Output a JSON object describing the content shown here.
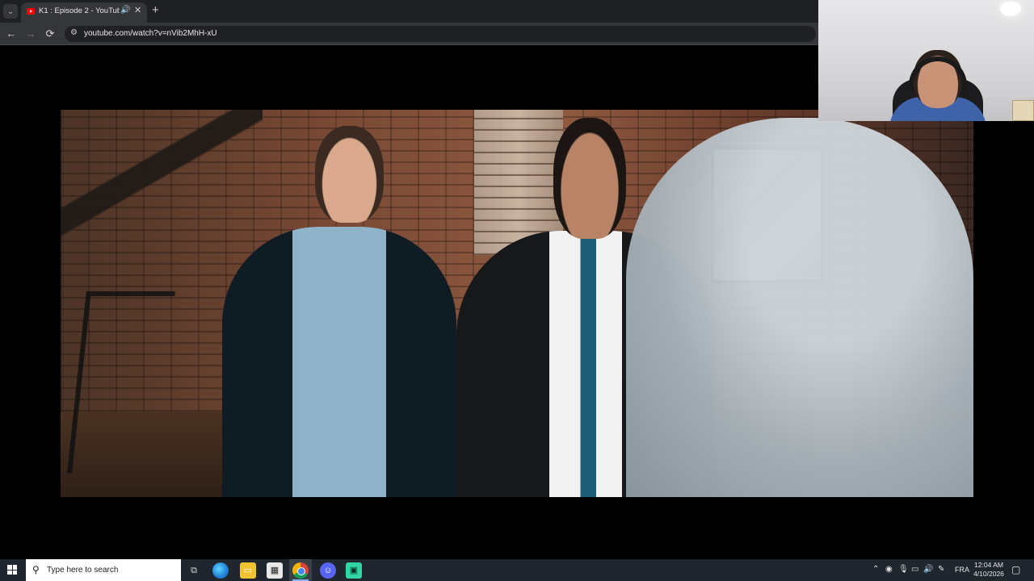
{
  "browser": {
    "tab": {
      "title": "K1 : Episode 2 - YouTube",
      "audio_icon": "speaker-icon",
      "close_icon": "close-icon"
    },
    "tab_menu_glyph": "⌄",
    "new_tab_glyph": "+",
    "nav": {
      "back_glyph": "←",
      "forward_glyph": "→",
      "reload_glyph": "⟳"
    },
    "address": {
      "site_info_icon": "tune-icon",
      "url": "youtube.com/watch?v=nVib2MhH-xU"
    }
  },
  "video": {
    "description_icon": "video-frame"
  },
  "webcam": {
    "icon": "webcam-overlay"
  },
  "taskbar": {
    "search_placeholder": "Type here to search",
    "apps": [
      "task-view",
      "edge",
      "file-explorer",
      "store",
      "chrome",
      "discord",
      "app"
    ],
    "language": "FRA",
    "time": "12:04 AM",
    "date": "4/10/2026"
  }
}
